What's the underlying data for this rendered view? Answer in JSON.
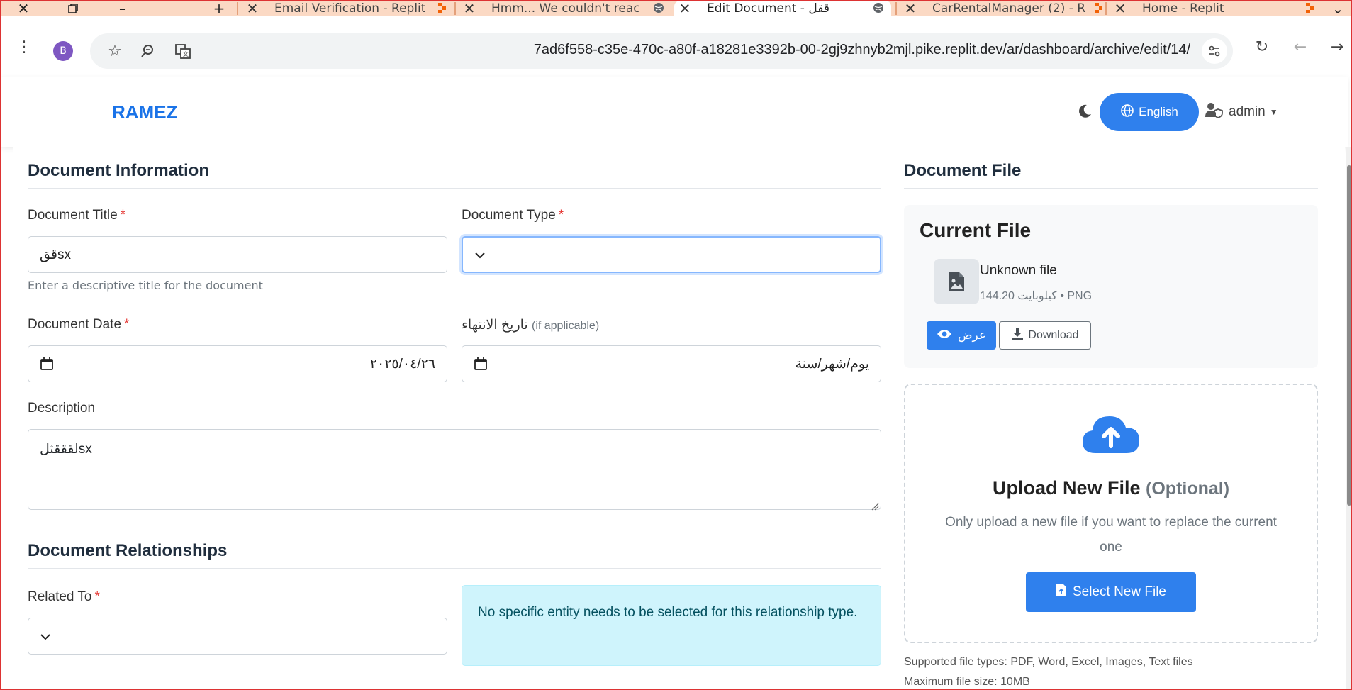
{
  "browser": {
    "tabs": [
      {
        "label": "Email Verification - Replit",
        "active": false
      },
      {
        "label": "Hmm... We couldn't reach",
        "active": false
      },
      {
        "label": "Edit Document - ققل",
        "active": true
      },
      {
        "label": "CarRentalManager (2) - R",
        "active": false
      },
      {
        "label": "Home - Replit",
        "active": false
      }
    ],
    "profile_initial": "B",
    "url": "7ad6f558-c35e-470c-a80f-a18281e3392b-00-2gj9zhnyb2mjl.pike.replit.dev/ar/dashboard/archive/edit/14/"
  },
  "header": {
    "brand": "RAMEZ",
    "language_button": "English",
    "user_label": "admin"
  },
  "document_info": {
    "section_title": "Document Information",
    "title_label": "Document Title",
    "title_value": "ققsx",
    "title_help": "Enter a descriptive title for the document",
    "type_label": "Document Type",
    "type_value": "",
    "date_label": "Document Date",
    "date_value": "٢٠٢٥/٠٤/٢٦",
    "expiry_label": "تاريخ الانتهاء",
    "expiry_note": "(if applicable)",
    "expiry_value": "يوم/شهر/سنة",
    "description_label": "Description",
    "description_value": "لقققثلsx"
  },
  "relationships": {
    "section_title": "Document Relationships",
    "related_label": "Related To",
    "related_value": "",
    "alert_text": "No specific entity needs to be selected for this relationship type."
  },
  "document_file": {
    "section_title": "Document File",
    "current_title": "Current File",
    "file_name": "Unknown file",
    "file_meta": "144.20 كيلوبايت • PNG",
    "view_button": "عرض",
    "download_button": "Download",
    "upload_title": "Upload New File",
    "upload_optional": "(Optional)",
    "upload_desc": "Only upload a new file if you want to replace the current one",
    "select_button": "Select New File",
    "supported": "Supported file types: PDF, Word, Excel, Images, Text files",
    "max_size": "Maximum file size: 10MB"
  },
  "colors": {
    "primary": "#2f80ed",
    "brand": "#1a73e8",
    "required": "#e53935",
    "alert_bg": "#cff4fc",
    "tab_strip": "#fbd9c4"
  }
}
